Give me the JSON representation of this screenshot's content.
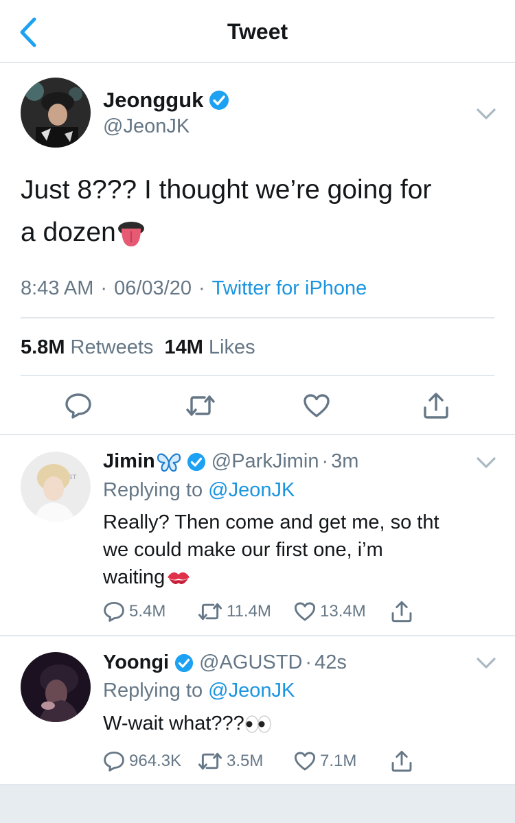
{
  "nav": {
    "title": "Tweet",
    "back_icon": "chevron-left-icon"
  },
  "main_tweet": {
    "name": "Jeongguk",
    "handle": "@JeonJK",
    "text_line1": "Just 8??? I thought we’re going for",
    "text_line2": "a dozen",
    "emoji": "tongue-emoji",
    "time": "8:43 AM",
    "date": "06/03/20",
    "source": "Twitter for iPhone",
    "retweets_count": "5.8M",
    "retweets_label": "Retweets",
    "likes_count": "14M",
    "likes_label": "Likes"
  },
  "replies": [
    {
      "name": "Jimin",
      "name_emoji": "butterfly-emoji",
      "handle": "@ParkJimin",
      "time": "3m",
      "replying_label": "Replying to",
      "replying_to": "@JeonJK",
      "text_line1": "Really? Then come and get me, so tht",
      "text_line2": "we could make our first one, i’m",
      "text_line3": "waiting",
      "text_emoji": "kiss-emoji",
      "replies": "5.4M",
      "retweets": "11.4M",
      "likes": "13.4M"
    },
    {
      "name": "Yoongi",
      "handle": "@AGUSTD",
      "time": "42s",
      "replying_label": "Replying to",
      "replying_to": "@JeonJK",
      "text_line1": "W-wait what???",
      "text_emoji": "eyes-emoji",
      "replies": "964.3K",
      "retweets": "3.5M",
      "likes": "7.1M"
    }
  ],
  "colors": {
    "accent": "#1da1f2",
    "link": "#1b95e0",
    "secondary_text": "#657786",
    "divider": "#e1e8ed"
  }
}
